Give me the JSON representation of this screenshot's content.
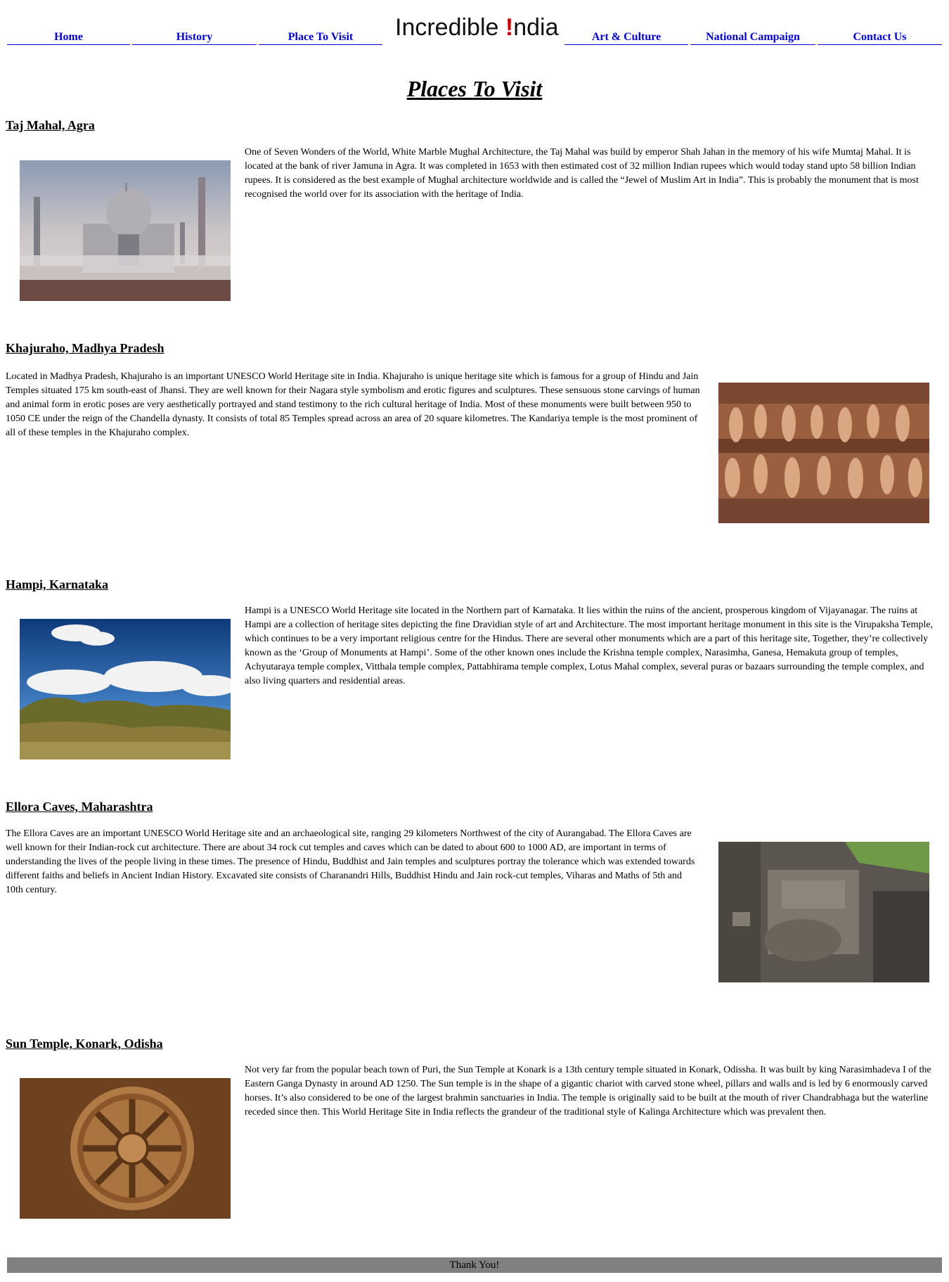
{
  "nav": {
    "home": "Home",
    "history": "History",
    "place_to_visit": "Place To Visit",
    "logo_pre": "Incredible ",
    "logo_bang": "!",
    "logo_post": "ndia",
    "art_culture": "Art & Culture",
    "national_campaign": "National Campaign",
    "contact_us": "Contact Us",
    "link_color": "#0000ee"
  },
  "page": {
    "title": "Places To Visit"
  },
  "sections": [
    {
      "title": "Taj Mahal, Agra",
      "text": "One of Seven Wonders of the World, White Marble Mughal Architecture, the Taj Mahal was build by emperor Shah Jahan in the memory of his wife Mumtaj Mahal. It is located at the bank of river Jamuna in Agra. It was completed in 1653 with then estimated cost of 32 million Indian rupees which would today stand upto 58 billion Indian rupees. It is considered as the best example of Mughal architecture worldwide and is called the “Jewel of Muslim Art in India”. This is probably the monument that is most recognised the world over for its association with the heritage of India."
    },
    {
      "title": "Khajuraho, Madhya Pradesh",
      "text": "Located in Madhya Pradesh, Khajuraho is an important UNESCO World Heritage site in India. Khajuraho is unique heritage site which is famous for a group of Hindu and Jain Temples situated 175 km south-east of Jhansi. They are well known for their Nagara style symbolism and erotic figures and sculptures. These sensuous stone carvings of human and animal form in erotic poses are very aesthetically portrayed and stand testimony to the rich cultural heritage of India. Most of these monuments were built between 950 to 1050 CE under the reign of the Chandella dynasty. It consists of total 85 Temples spread across an area of 20 square kilometres. The Kandariya temple is the most prominent of all of these temples in the Khajuraho complex."
    },
    {
      "title": "Hampi, Karnataka",
      "text": "Hampi is a UNESCO World Heritage site located in the Northern part of Karnataka. It lies within the ruins of the ancient, prosperous kingdom of Vijayanagar. The ruins at Hampi are a collection of heritage sites depicting the fine Dravidian style of art and Architecture. The most important heritage monument in this site is the Virupaksha Temple, which continues to be a very important religious centre for the Hindus. There are several other monuments which are a part of this heritage site, Together, they’re collectively known as the ‘Group of Monuments at Hampi’. Some of the other known ones include the Krishna temple complex, Narasimha, Ganesa, Hemakuta group of temples, Achyutaraya temple complex, Vitthala temple complex, Pattabhirama temple complex, Lotus Mahal complex, several puras or bazaars surrounding the temple complex, and also living quarters and residential areas."
    },
    {
      "title": "Ellora Caves, Maharashtra",
      "text": "The Ellora Caves are an important UNESCO World Heritage site and an archaeological site, ranging 29 kilometers Northwest of the city of Aurangabad. The Ellora Caves are well known for their Indian-rock cut architecture. There are about 34 rock cut temples and caves which can be dated to about 600 to 1000 AD, are important in terms of understanding the lives of the people living in these times. The presence of Hindu, Buddhist and Jain temples and sculptures portray the tolerance which was extended towards different faiths and beliefs in Ancient Indian History. Excavated site consists of Charanandri Hills, Buddhist Hindu and Jain rock-cut temples, Viharas and Maths of 5th and 10th century."
    },
    {
      "title": "Sun Temple, Konark, Odisha",
      "text": "Not very far from the popular beach town of Puri, the Sun Temple at Konark is a 13th century temple situated in Konark, Odissha. It was built by king Narasimhadeva I of the Eastern Ganga Dynasty in around AD 1250. The Sun temple is in the shape of a gigantic chariot with carved stone wheel, pillars and walls and is led by 6 enormously carved horses. It’s also considered to be one of the largest brahmin sanctuaries in India. The temple is originally said to be built at the mouth of river Chandrabhaga but the waterline receded since then. This World Heritage Site in India reflects the grandeur of the traditional style of Kalinga Architecture which was prevalent then."
    }
  ],
  "footer": {
    "text": "Thank You!",
    "bg_color": "#808080"
  }
}
